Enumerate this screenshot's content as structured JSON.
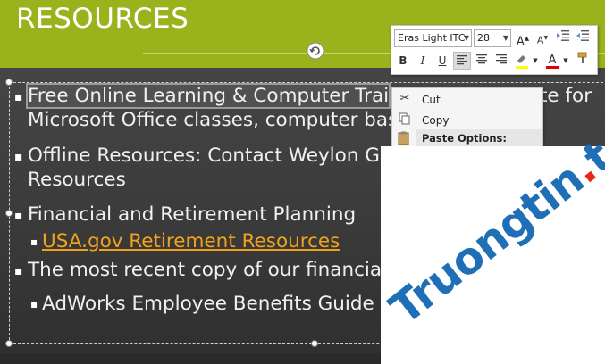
{
  "slide": {
    "title": "RESOURCES",
    "bullets": [
      {
        "line1": "Free Online Learning & Computer Training: Visit our website for",
        "line1_visible_left": "Free Online Learning & Computer Trai",
        "line1_visible_right": "ite for",
        "line2": "Microsoft Office classes,  computer basic"
      },
      {
        "line1": "Offline Resources: Contact Weylon Gle",
        "line2": "Resources"
      },
      {
        "line1": "Financial and Retirement Planning",
        "sub": "USA.gov Retirement Resources"
      },
      {
        "line1": "The most recent copy of our financial r",
        "sub": "AdWorks Employee Benefits Guide"
      }
    ]
  },
  "mini_toolbar": {
    "font_name": "Eras Light ITC",
    "font_size": "28",
    "grow_font": "A",
    "shrink_font": "A",
    "bold": "B",
    "italic": "I",
    "underline": "U",
    "font_color": "A",
    "highlight_color": "#ffff00",
    "font_color_bar": "#e00000"
  },
  "context_menu": {
    "cut": "Cut",
    "copy": "Copy",
    "paste_options": "Paste Options:"
  },
  "watermark": {
    "text_main": "Truongtin",
    "text_dot": ".",
    "text_end": "top"
  }
}
